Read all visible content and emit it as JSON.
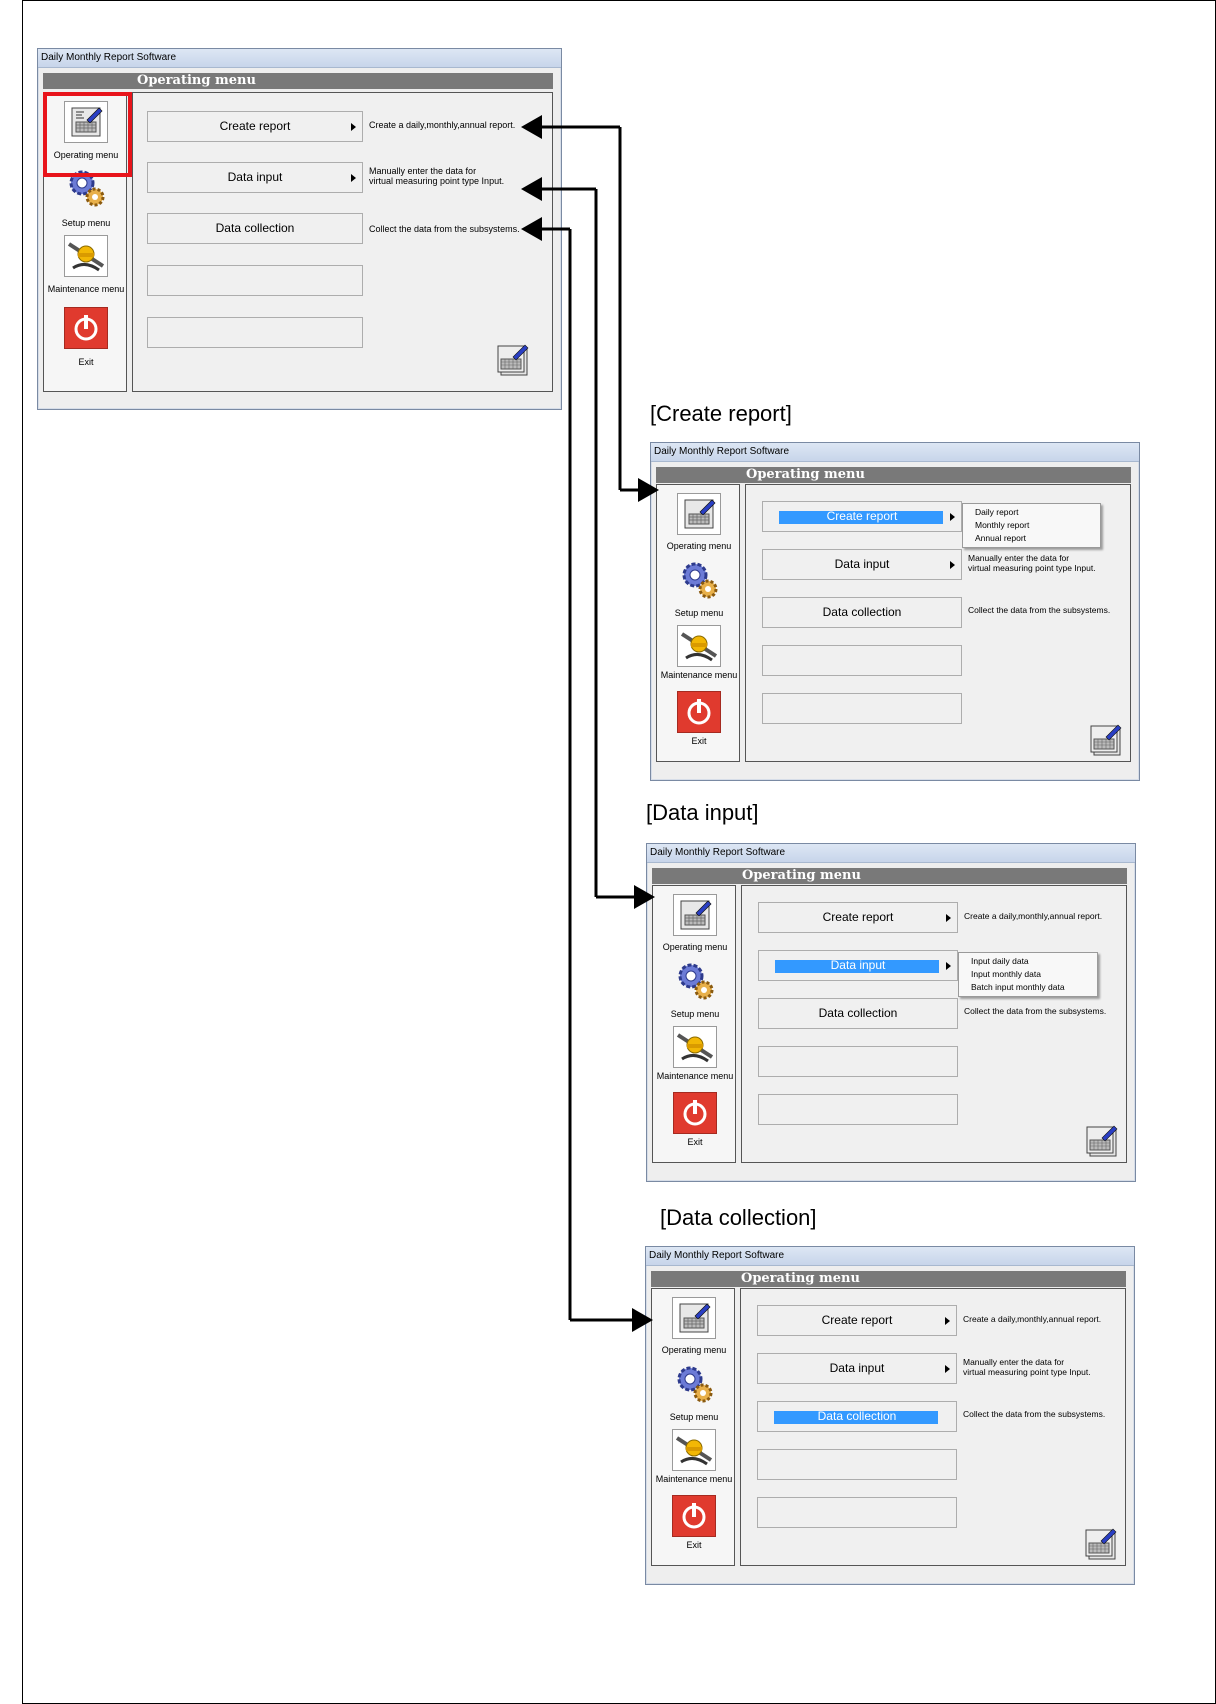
{
  "window_title": "Daily Monthly Report Software",
  "header_title": "Operating menu",
  "side_menu": [
    {
      "label": "Operating menu",
      "icon": "report-sheet-icon"
    },
    {
      "label": "Setup menu",
      "icon": "gears-icon"
    },
    {
      "label": "Maintenance menu",
      "icon": "tools-icon"
    },
    {
      "label": "Exit",
      "icon": "power-icon"
    }
  ],
  "main_buttons": [
    {
      "label": "Create report",
      "has_submenu": true
    },
    {
      "label": "Data input",
      "has_submenu": true
    },
    {
      "label": "Data collection",
      "has_submenu": false
    }
  ],
  "descriptions": {
    "create_report": "Create a daily,monthly,annual report.",
    "data_input_line1": "Manually enter the data for",
    "data_input_line2": "virtual measuring point type Input.",
    "data_collection": "Collect the data from the subsystems."
  },
  "sections": [
    {
      "label": "[Create report]"
    },
    {
      "label": "[Data input]"
    },
    {
      "label": "[Data collection]"
    }
  ],
  "create_report_submenu": [
    "Daily report",
    "Monthly report",
    "Annual report"
  ],
  "data_input_submenu": [
    "Input daily data",
    "Input monthly data",
    "Batch input monthly data"
  ],
  "colors": {
    "selection": "#3399ff",
    "highlight_box": "#e8141b",
    "header_strip": "#797979"
  }
}
